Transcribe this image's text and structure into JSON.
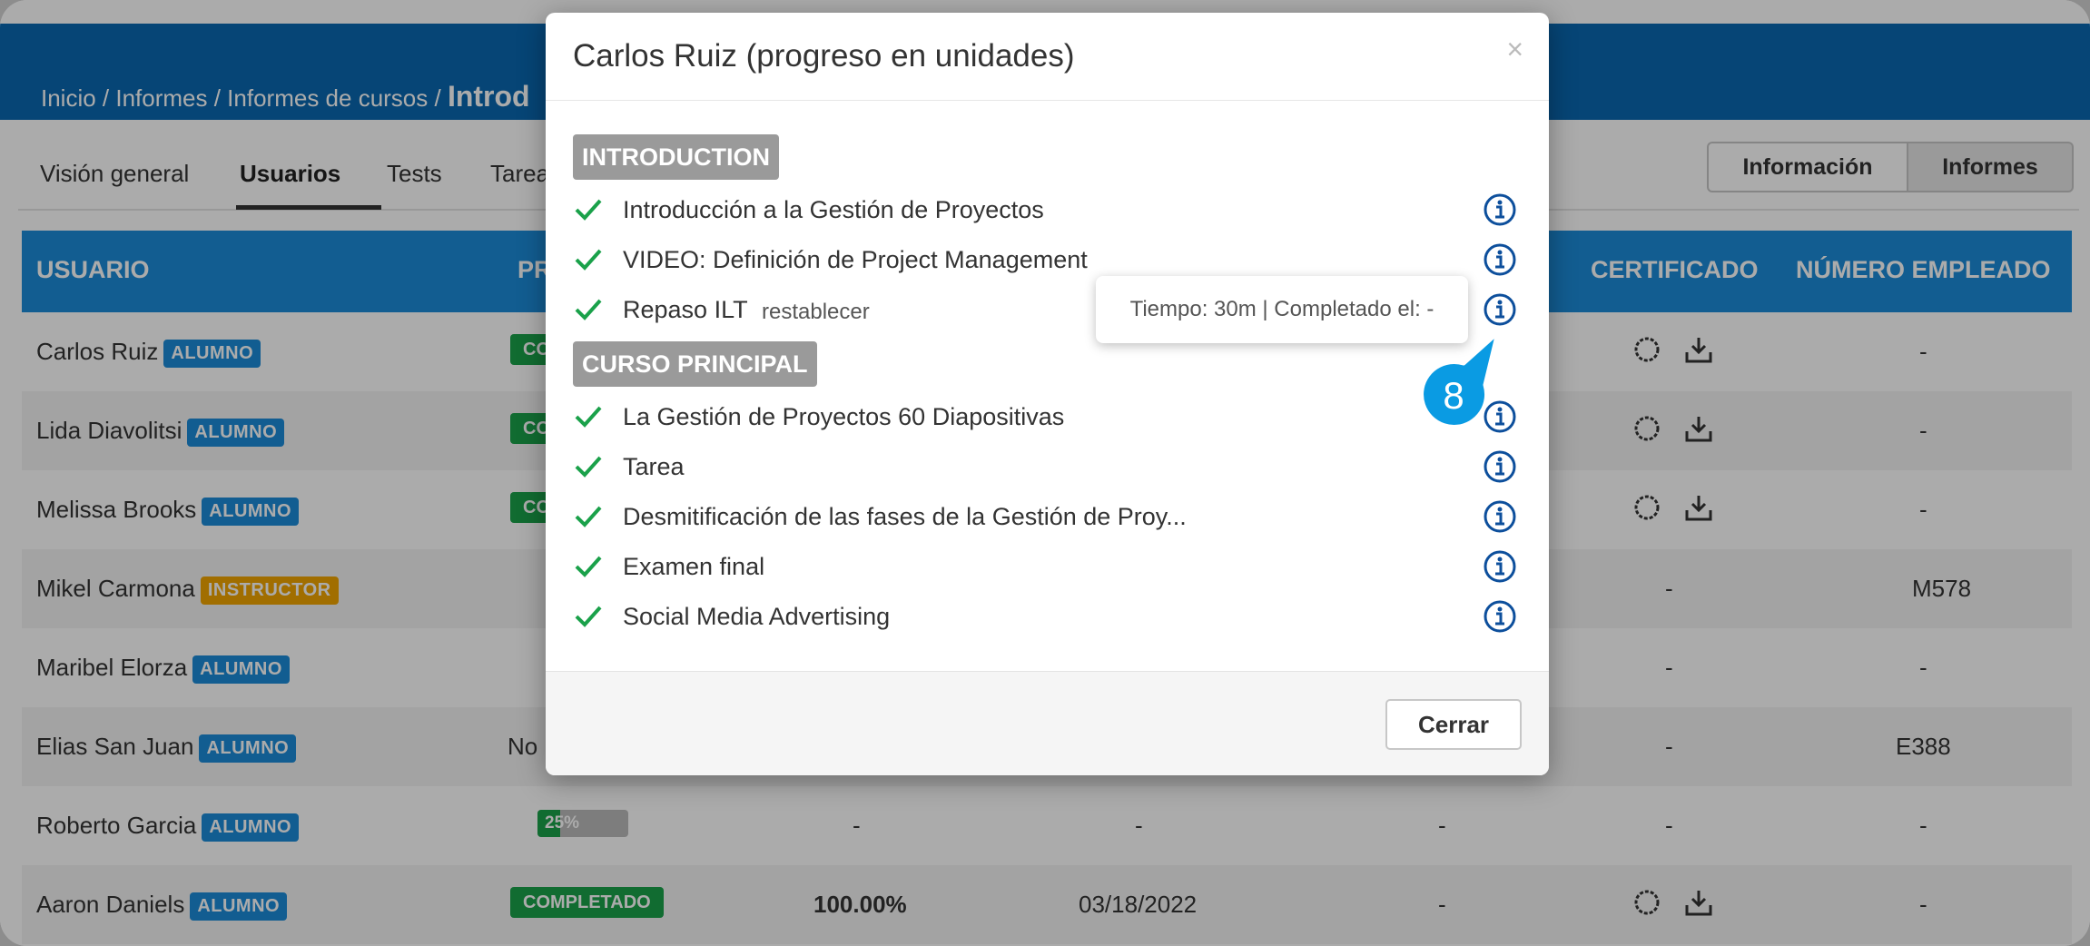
{
  "breadcrumb": {
    "parts": "Inicio / Informes / Informes de cursos / ",
    "current": "Introd"
  },
  "tabs": [
    "Visión general",
    "Usuarios",
    "Tests",
    "Tareas"
  ],
  "toggles": {
    "info": "Información",
    "reports": "Informes"
  },
  "table": {
    "headers": {
      "user": "USUARIO",
      "progress": "PR",
      "certificate": "CERTIFICADO",
      "employee": "NÚMERO EMPLEADO"
    },
    "rows": [
      {
        "name": "Carlos Ruiz",
        "role": "ALUMNO",
        "status": "CO",
        "cert": "-",
        "emp": "-"
      },
      {
        "name": "Lida Diavolitsi",
        "role": "ALUMNO",
        "status": "CO",
        "cert": "-",
        "emp": "-"
      },
      {
        "name": "Melissa Brooks",
        "role": "ALUMNO",
        "status": "CO",
        "cert": "-",
        "emp": "-"
      },
      {
        "name": "Mikel Carmona",
        "role": "INSTRUCTOR",
        "cert": "-",
        "emp": "M578"
      },
      {
        "name": "Maribel Elorza",
        "role": "ALUMNO",
        "cert": "-",
        "emp": "-"
      },
      {
        "name": "Elias San Juan",
        "role": "ALUMNO",
        "status_text": "No",
        "cert": "-",
        "emp": "E388"
      },
      {
        "name": "Roberto Garcia",
        "role": "ALUMNO",
        "progress_label": "25%",
        "progress": 0.25,
        "score": "-",
        "date": "-",
        "time": "-",
        "cert": "-",
        "emp": "-"
      },
      {
        "name": "Aaron Daniels",
        "role": "ALUMNO",
        "status": "COMPLETADO",
        "score": "100.00%",
        "date": "03/18/2022",
        "time": "-",
        "emp": "-"
      }
    ]
  },
  "modal": {
    "title": "Carlos Ruiz (progreso en unidades)",
    "close_x": "×",
    "sections": [
      "INTRODUCTION",
      "CURSO PRINCIPAL"
    ],
    "units_intro": [
      "Introducción a la Gestión de Proyectos",
      "VIDEO: Definición de Project Management",
      "Repaso ILT"
    ],
    "reset_label": "restablecer",
    "units_main": [
      "La Gestión de Proyectos 60 Diapositivas",
      "Tarea",
      "Desmitificación de las fases de la Gestión de Proy...",
      "Examen final",
      "Social Media Advertising"
    ],
    "tooltip": "Tiempo: 30m | Completado el: -",
    "close_button": "Cerrar"
  },
  "callout_number": "8",
  "colors": {
    "accent": "#1b8bd8",
    "topbar": "#0a68b0",
    "success": "#1aa14a",
    "callout": "#0a9be3",
    "info_icon": "#0d4f9c"
  }
}
